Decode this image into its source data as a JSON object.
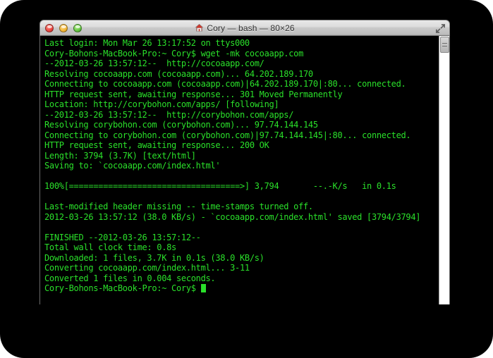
{
  "window": {
    "title": "Cory — bash — 80×26",
    "home_icon": "home-icon",
    "fullscreen_icon": "fullscreen-arrows-icon",
    "traffic_lights": {
      "close_label": "Close",
      "minimize_label": "Minimize",
      "zoom_label": "Zoom"
    },
    "colors": {
      "terminal_background": "#000000",
      "terminal_text": "#2ae02a",
      "page_background": "#000000",
      "close_button": "#e8403a",
      "minimize_button": "#f0b32e",
      "zoom_button": "#5ec23c"
    }
  },
  "terminal": {
    "lines": [
      "Last login: Mon Mar 26 13:17:52 on ttys000",
      "Cory-Bohons-MacBook-Pro:~ Cory$ wget -mk cocoaapp.com",
      "--2012-03-26 13:57:12--  http://cocoaapp.com/",
      "Resolving cocoaapp.com (cocoaapp.com)... 64.202.189.170",
      "Connecting to cocoaapp.com (cocoaapp.com)|64.202.189.170|:80... connected.",
      "HTTP request sent, awaiting response... 301 Moved Permanently",
      "Location: http://corybohon.com/apps/ [following]",
      "--2012-03-26 13:57:12--  http://corybohon.com/apps/",
      "Resolving corybohon.com (corybohon.com)... 97.74.144.145",
      "Connecting to corybohon.com (corybohon.com)|97.74.144.145|:80... connected.",
      "HTTP request sent, awaiting response... 200 OK",
      "Length: 3794 (3.7K) [text/html]",
      "Saving to: `cocoaapp.com/index.html'",
      "",
      "100%[===================================>] 3,794       --.-K/s   in 0.1s",
      "",
      "Last-modified header missing -- time-stamps turned off.",
      "2012-03-26 13:57:12 (38.0 KB/s) - `cocoaapp.com/index.html' saved [3794/3794]",
      "",
      "FINISHED --2012-03-26 13:57:12--",
      "Total wall clock time: 0.8s",
      "Downloaded: 1 files, 3.7K in 0.1s (38.0 KB/s)",
      "Converting cocoaapp.com/index.html... 3-11",
      "Converted 1 files in 0.004 seconds."
    ],
    "prompt": "Cory-Bohons-MacBook-Pro:~ Cory$ ",
    "cursor": "block-cursor"
  },
  "scrollbar": {
    "name": "vertical-scrollbar",
    "thumb": "scrollbar-thumb"
  }
}
